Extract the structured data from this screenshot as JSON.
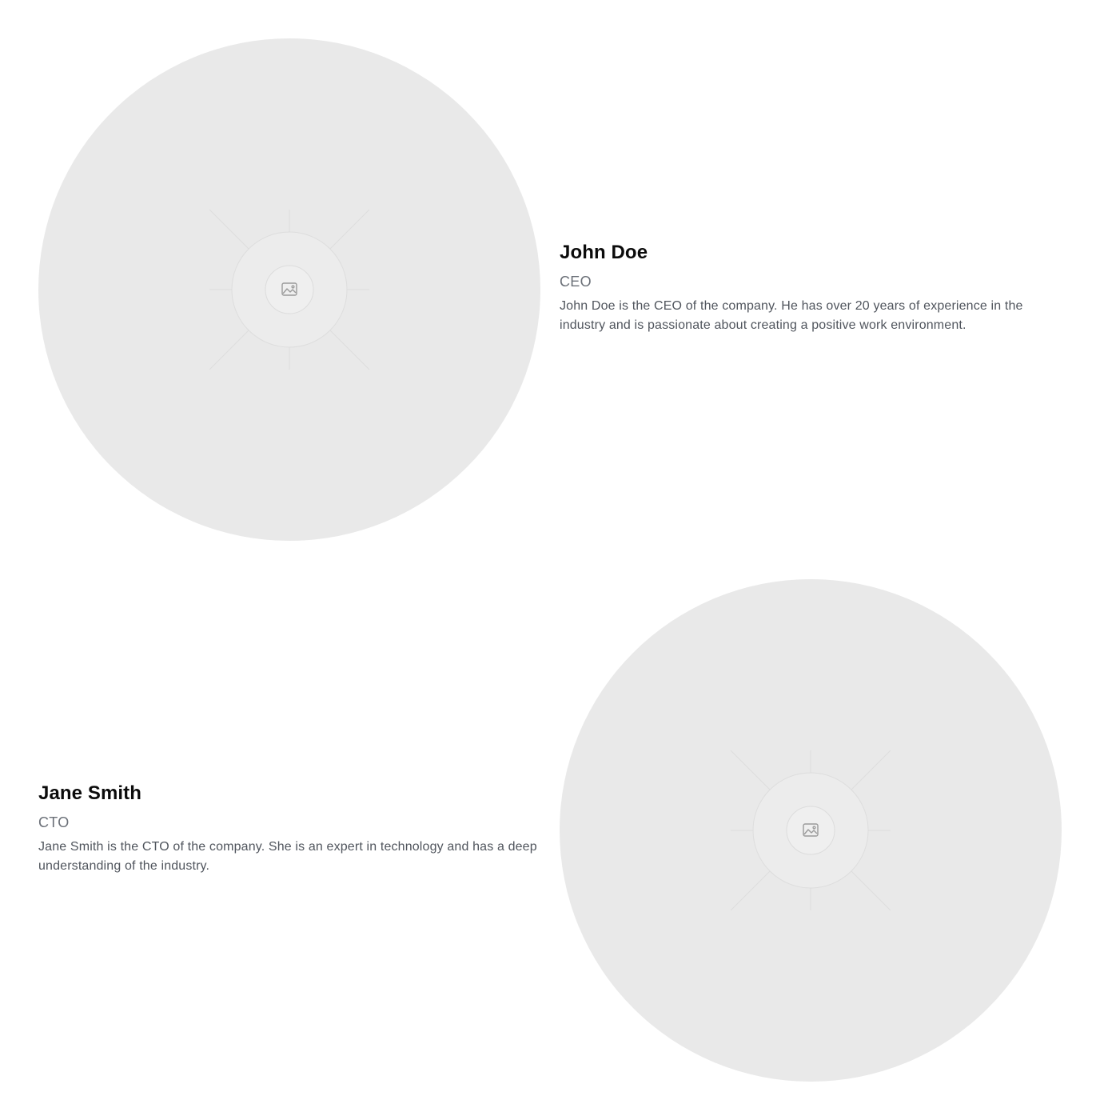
{
  "team": [
    {
      "name": "John Doe",
      "role": "CEO",
      "bio": "John Doe is the CEO of the company. He has over 20 years of experience in the industry and is passionate about creating a positive work environment.",
      "photo_icon": "image-placeholder-icon"
    },
    {
      "name": "Jane Smith",
      "role": "CTO",
      "bio": "Jane Smith is the CTO of the company. She is an expert in technology and has a deep understanding of the industry.",
      "photo_icon": "image-placeholder-icon"
    }
  ],
  "colors": {
    "background": "#ffffff",
    "photo_placeholder": "#e9e9e9",
    "name_text": "#0b0b0b",
    "role_text": "#6b7078",
    "bio_text": "#50555d"
  }
}
